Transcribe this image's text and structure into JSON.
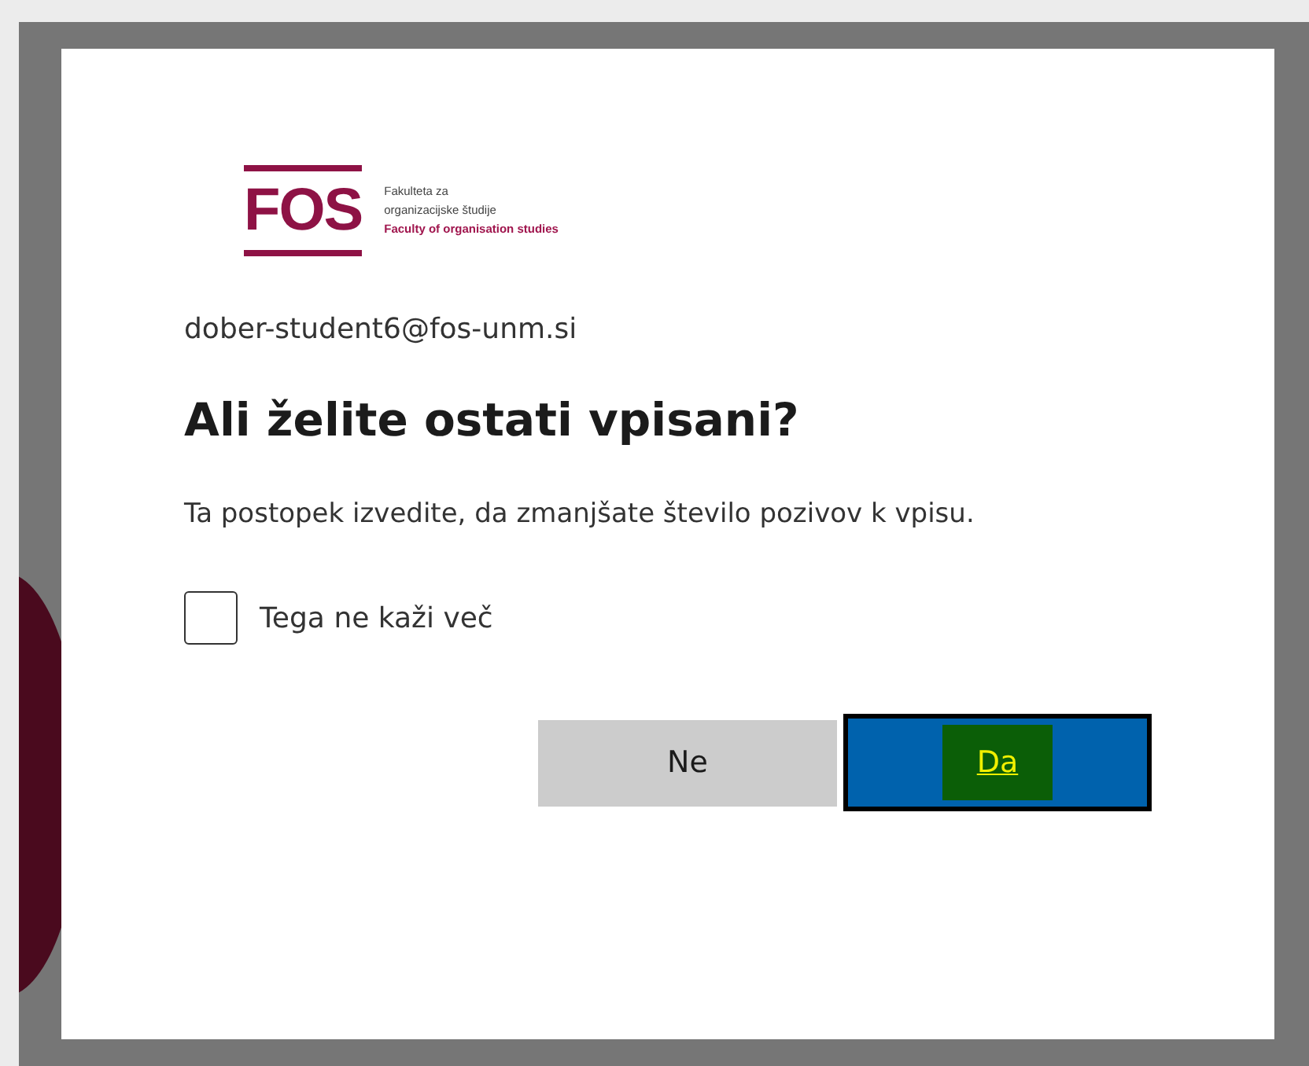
{
  "logo": {
    "mark": "FOS",
    "lines": [
      "Fakulteta za",
      "organizacijske študije",
      "Faculty of organisation studies"
    ]
  },
  "account": "dober-student6@fos-unm.si",
  "title": "Ali želite ostati vpisani?",
  "description": "Ta postopek izvedite, da zmanjšate število pozivov k vpisu.",
  "checkbox": {
    "label": "Tega ne kaži več",
    "checked": false
  },
  "buttons": [
    {
      "label": "Ne",
      "kind": "secondary",
      "focused": false
    },
    {
      "label": "Da",
      "kind": "primary",
      "focused": true
    }
  ]
}
